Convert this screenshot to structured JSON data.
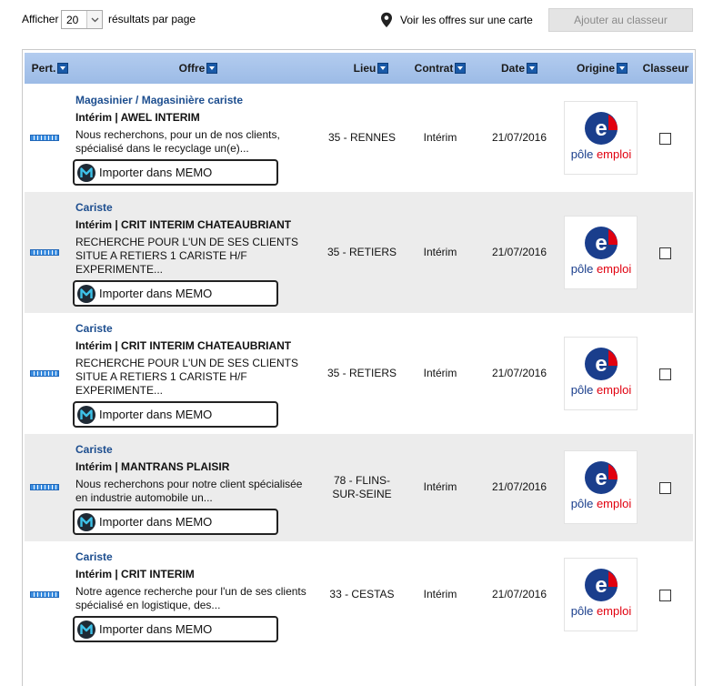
{
  "toolbar": {
    "show_label": "Afficher",
    "per_page_value": "20",
    "per_page_suffix": "résultats par page",
    "map_link": "Voir les offres sur une carte",
    "add_button": "Ajouter au classeur"
  },
  "table": {
    "headers": [
      "Pert.",
      "Offre",
      "Lieu",
      "Contrat",
      "Date",
      "Origine",
      "Classeur"
    ],
    "memo_label": "Importer dans MEMO",
    "logo_line1": "pôle",
    "logo_line2": "emploi",
    "rows": [
      {
        "title": "Magasinier / Magasinière cariste",
        "company": "Intérim | AWEL INTERIM",
        "desc_lines": [
          "Nous recherchons, pour un de nos clients,",
          "spécialisé dans le recyclage un(e)..."
        ],
        "lieu_lines": [
          "35 - RENNES"
        ],
        "contrat": "Intérim",
        "date": "21/07/2016"
      },
      {
        "title": "Cariste",
        "company": "Intérim | CRIT INTERIM CHATEAUBRIANT",
        "desc_lines": [
          "RECHERCHE POUR L'UN DE SES CLIENTS",
          "SITUE A RETIERS 1 CARISTE H/F",
          "EXPERIMENTE..."
        ],
        "lieu_lines": [
          "35 - RETIERS"
        ],
        "contrat": "Intérim",
        "date": "21/07/2016"
      },
      {
        "title": "Cariste",
        "company": "Intérim | CRIT INTERIM CHATEAUBRIANT",
        "desc_lines": [
          "RECHERCHE POUR L'UN DE SES CLIENTS",
          "SITUE A RETIERS 1 CARISTE H/F",
          "EXPERIMENTE..."
        ],
        "lieu_lines": [
          "35 - RETIERS"
        ],
        "contrat": "Intérim",
        "date": "21/07/2016"
      },
      {
        "title": "Cariste",
        "company": "Intérim | MANTRANS PLAISIR",
        "desc_lines": [
          "Nous recherchons pour notre client spécialisée",
          "en industrie automobile un..."
        ],
        "lieu_lines": [
          "78 - FLINS-",
          "SUR-SEINE"
        ],
        "contrat": "Intérim",
        "date": "21/07/2016"
      },
      {
        "title": "Cariste",
        "company": "Intérim | CRIT INTERIM",
        "desc_lines": [
          "Notre agence recherche pour l'un de ses clients",
          "spécialisé en logistique, des..."
        ],
        "lieu_lines": [
          "33 - CESTAS"
        ],
        "contrat": "Intérim",
        "date": "21/07/2016"
      }
    ]
  },
  "colors": {
    "header_bg": "#a8c4ec",
    "link_blue": "#1d4e8f",
    "pole_emploi_blue": "#1a3e8c",
    "pole_emploi_red": "#e1000f",
    "alt_row_bg": "#ececec"
  },
  "icons": {
    "map": "map-pin-icon",
    "sort": "sort-arrow-icon",
    "memo": "memo-logo-icon",
    "pertinence": "pertinence-bar-icon"
  }
}
